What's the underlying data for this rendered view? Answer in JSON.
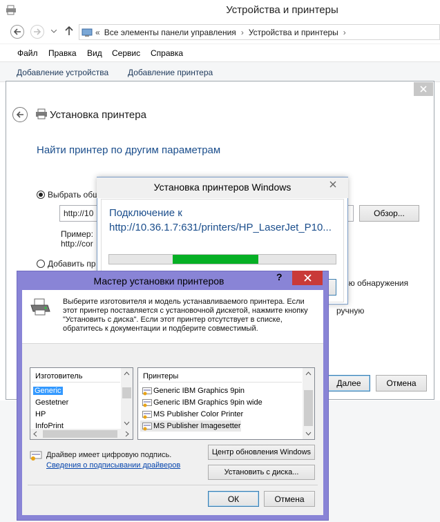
{
  "window": {
    "title": "Устройства и принтеры"
  },
  "address": {
    "crumbs": [
      "Все элементы панели управления",
      "Устройства и принтеры"
    ]
  },
  "menu": [
    "Файл",
    "Правка",
    "Вид",
    "Сервис",
    "Справка"
  ],
  "commands": [
    "Добавление устройства",
    "Добавление принтера"
  ],
  "wizard": {
    "header": "Установка принтера",
    "subtitle": "Найти принтер по другим параметрам",
    "radio1_label": "Выбрать общ",
    "url_value": "http://10",
    "browse_label": "Обзор...",
    "example_line1": "Пример:",
    "example_line2": "http://cor",
    "radio2_label": "Добавить пр",
    "right_text1": "стью обнаружения",
    "right_text2": "ручную",
    "next_label": "Далее",
    "cancel_label": "Отмена"
  },
  "progress": {
    "title": "Установка принтеров Windows",
    "line1": "Подключение к",
    "line2": "http://10.36.1.7:631/printers/HP_LaserJet_P10...",
    "fill_fraction": 0.38
  },
  "master": {
    "title": "Мастер установки принтеров",
    "help": "?",
    "description": "Выберите изготовителя и модель устанавливаемого принтера. Если этот принтер поставляется с установочной дискетой, нажмите кнопку \"Установить с диска\". Если этот принтер отсутствует в списке, обратитесь к документации и подберите совместимый.",
    "manufacturer_header": "Изготовитель",
    "manufacturers": [
      "Generic",
      "Gestetner",
      "HP",
      "InfoPrint"
    ],
    "printers_header": "Принтеры",
    "printers": [
      "Generic IBM Graphics 9pin",
      "Generic IBM Graphics 9pin wide",
      "MS Publisher Color Printer",
      "MS Publisher Imagesetter"
    ],
    "signed_text": "Драйвер имеет цифровую подпись.",
    "signing_link": "Сведения о подписывании драйверов",
    "windows_update": "Центр обновления Windows",
    "have_disk": "Установить с диска...",
    "ok": "ОК",
    "cancel": "Отмена"
  }
}
